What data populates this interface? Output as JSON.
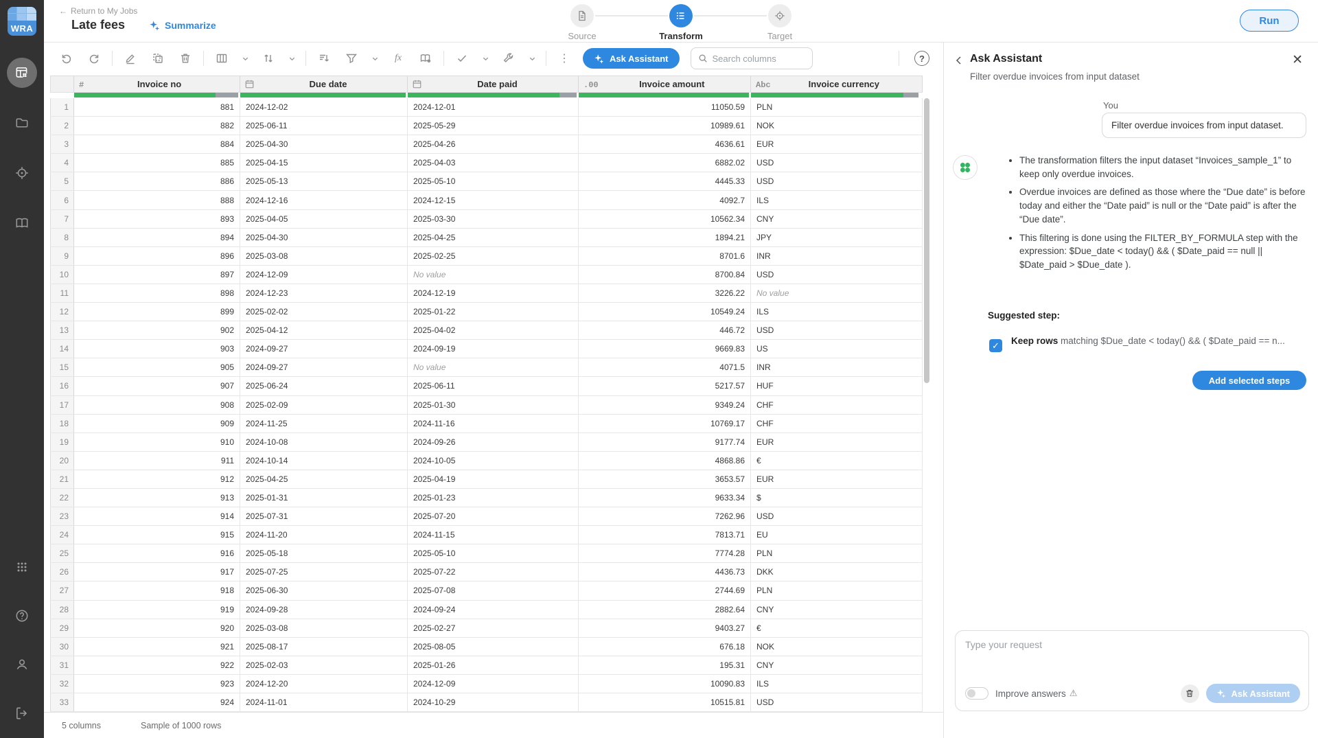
{
  "colors": {
    "accent": "#2f88e0",
    "quality_green": "#3cb55f",
    "quality_gray": "#9aa0a6"
  },
  "logo_text": "WRA",
  "sidebar": {
    "items": [
      "transform-grid",
      "projects-folder",
      "target",
      "library-book"
    ],
    "bottom_items": [
      "apps-grid",
      "help",
      "account",
      "logout"
    ]
  },
  "topbar": {
    "back_label": "Return to My Jobs",
    "title": "Late fees",
    "summarize_label": "Summarize",
    "steps": [
      {
        "label": "Source",
        "active": false
      },
      {
        "label": "Transform",
        "active": true
      },
      {
        "label": "Target",
        "active": false
      }
    ],
    "run_label": "Run"
  },
  "toolbar": {
    "ask_assistant_label": "Ask Assistant",
    "search_placeholder": "Search columns"
  },
  "table": {
    "no_value_text": "No value",
    "columns": [
      {
        "name": "Invoice no",
        "type": "number",
        "green": 0.86,
        "gray": 0.14
      },
      {
        "name": "Due date",
        "type": "date",
        "green": 1,
        "gray": 0
      },
      {
        "name": "Date paid",
        "type": "date",
        "green": 0.9,
        "gray": 0.1
      },
      {
        "name": "Invoice amount",
        "type": "decimal",
        "green": 1,
        "gray": 0
      },
      {
        "name": "Invoice currency",
        "type": "text",
        "green": 0.9,
        "gray": 0.09
      }
    ],
    "rows": [
      [
        "881",
        "2024-12-02",
        "2024-12-01",
        "11050.59",
        "PLN"
      ],
      [
        "882",
        "2025-06-11",
        "2025-05-29",
        "10989.61",
        "NOK"
      ],
      [
        "884",
        "2025-04-30",
        "2025-04-26",
        "4636.61",
        "EUR"
      ],
      [
        "885",
        "2025-04-15",
        "2025-04-03",
        "6882.02",
        "USD"
      ],
      [
        "886",
        "2025-05-13",
        "2025-05-10",
        "4445.33",
        "USD"
      ],
      [
        "888",
        "2024-12-16",
        "2024-12-15",
        "4092.7",
        "ILS"
      ],
      [
        "893",
        "2025-04-05",
        "2025-03-30",
        "10562.34",
        "CNY"
      ],
      [
        "894",
        "2025-04-30",
        "2025-04-25",
        "1894.21",
        "JPY"
      ],
      [
        "896",
        "2025-03-08",
        "2025-02-25",
        "8701.6",
        "INR"
      ],
      [
        "897",
        "2024-12-09",
        "No value",
        "8700.84",
        "USD"
      ],
      [
        "898",
        "2024-12-23",
        "2024-12-19",
        "3226.22",
        "No value"
      ],
      [
        "899",
        "2025-02-02",
        "2025-01-22",
        "10549.24",
        "ILS"
      ],
      [
        "902",
        "2025-04-12",
        "2025-04-02",
        "446.72",
        "USD"
      ],
      [
        "903",
        "2024-09-27",
        "2024-09-19",
        "9669.83",
        "US"
      ],
      [
        "905",
        "2024-09-27",
        "No value",
        "4071.5",
        "INR"
      ],
      [
        "907",
        "2025-06-24",
        "2025-06-11",
        "5217.57",
        "HUF"
      ],
      [
        "908",
        "2025-02-09",
        "2025-01-30",
        "9349.24",
        "CHF"
      ],
      [
        "909",
        "2024-11-25",
        "2024-11-16",
        "10769.17",
        "CHF"
      ],
      [
        "910",
        "2024-10-08",
        "2024-09-26",
        "9177.74",
        "EUR"
      ],
      [
        "911",
        "2024-10-14",
        "2024-10-05",
        "4868.86",
        "€"
      ],
      [
        "912",
        "2025-04-25",
        "2025-04-19",
        "3653.57",
        "EUR"
      ],
      [
        "913",
        "2025-01-31",
        "2025-01-23",
        "9633.34",
        "$"
      ],
      [
        "914",
        "2025-07-31",
        "2025-07-20",
        "7262.96",
        "USD"
      ],
      [
        "915",
        "2024-11-20",
        "2024-11-15",
        "7813.71",
        "EU"
      ],
      [
        "916",
        "2025-05-18",
        "2025-05-10",
        "7774.28",
        "PLN"
      ],
      [
        "917",
        "2025-07-25",
        "2025-07-22",
        "4436.73",
        "DKK"
      ],
      [
        "918",
        "2025-06-30",
        "2025-07-08",
        "2744.69",
        "PLN"
      ],
      [
        "919",
        "2024-09-28",
        "2024-09-24",
        "2882.64",
        "CNY"
      ],
      [
        "920",
        "2025-03-08",
        "2025-02-27",
        "9403.27",
        "€"
      ],
      [
        "921",
        "2025-08-17",
        "2025-08-05",
        "676.18",
        "NOK"
      ],
      [
        "922",
        "2025-02-03",
        "2025-01-26",
        "195.31",
        "CNY"
      ],
      [
        "923",
        "2024-12-20",
        "2024-12-09",
        "10090.83",
        "ILS"
      ],
      [
        "924",
        "2024-11-01",
        "2024-10-29",
        "10515.81",
        "USD"
      ]
    ]
  },
  "statusbar": {
    "columns_label": "5 columns",
    "sample_label": "Sample of 1000 rows"
  },
  "panel": {
    "title": "Ask Assistant",
    "subtitle": "Filter overdue invoices from input dataset",
    "you_label": "You",
    "user_message": "Filter overdue invoices from input dataset.",
    "bullets": [
      "The transformation filters the input dataset “Invoices_sample_1” to keep only overdue invoices.",
      "Overdue invoices are defined as those where the “Due date” is before today and either the “Date paid” is null or the “Date paid” is after the “Due date”.",
      "This filtering is done using the FILTER_BY_FORMULA step with the expression: $Due_date < today() && ( $Date_paid == null || $Date_paid > $Due_date )."
    ],
    "suggested_label": "Suggested step:",
    "step_bold": "Keep rows",
    "step_rest": " matching $Due_date < today() && ( $Date_paid == n...",
    "add_button_label": "Add selected steps",
    "input_placeholder": "Type your request",
    "improve_label": "Improve answers",
    "ask_button_label": "Ask Assistant"
  }
}
